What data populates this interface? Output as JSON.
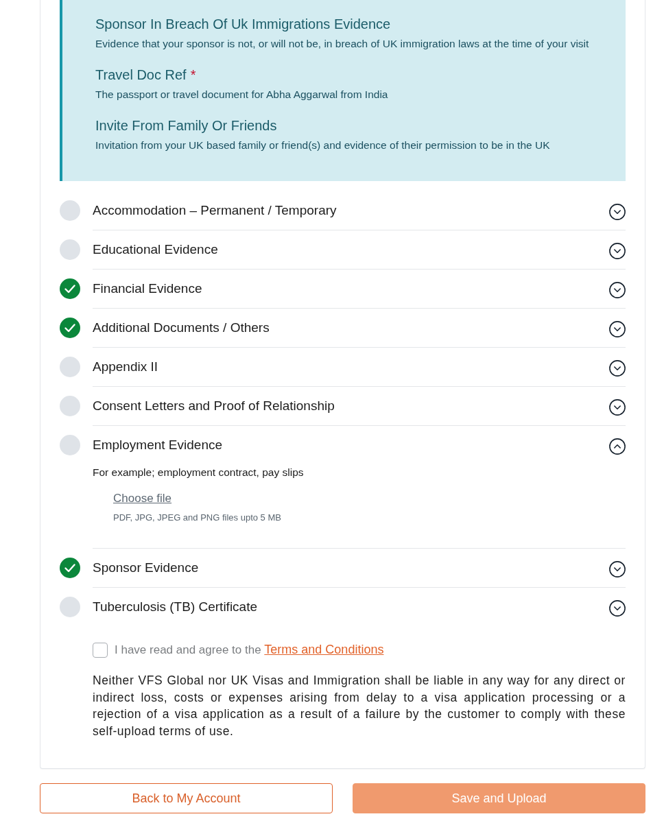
{
  "info_panel": {
    "items": [
      {
        "title": "Sponsor In Breach Of Uk Immigrations Evidence",
        "description": "Evidence that your sponsor is not, or will not be, in breach of UK immigration laws at the time of your visit"
      },
      {
        "title": "Travel Doc Ref",
        "required_mark": "*",
        "description": "The passport or travel document for Abha Aggarwal from India"
      },
      {
        "title": "Invite From Family Or Friends",
        "description": "Invitation from your UK based family or friend(s) and evidence of their permission to be in the UK"
      }
    ]
  },
  "documents": [
    {
      "title": "Accommodation – Permanent / Temporary",
      "uploaded": false,
      "expanded": false
    },
    {
      "title": "Educational Evidence",
      "uploaded": false,
      "expanded": false
    },
    {
      "title": "Financial Evidence",
      "uploaded": true,
      "expanded": false
    },
    {
      "title": "Additional Documents / Others",
      "uploaded": true,
      "expanded": false
    },
    {
      "title": "Appendix II",
      "uploaded": false,
      "expanded": false
    },
    {
      "title": "Consent Letters and Proof of Relationship",
      "uploaded": false,
      "expanded": false
    },
    {
      "title": "Employment Evidence",
      "uploaded": false,
      "expanded": true,
      "hint": "For example; employment contract, pay slips",
      "choose_file": "Choose file",
      "file_types": "PDF, JPG, JPEG and PNG files upto 5 MB"
    },
    {
      "title": "Sponsor Evidence",
      "uploaded": true,
      "expanded": false
    },
    {
      "title": "Tuberculosis (TB) Certificate",
      "uploaded": false,
      "expanded": false
    }
  ],
  "terms": {
    "checked": false,
    "text": "I have read and agree to the",
    "link": "Terms and Conditions"
  },
  "disclaimer": "Neither VFS Global nor UK Visas and Immigration shall be liable in any way for any direct or indirect loss, costs or expenses arising from delay to a visa application processing or a rejection of a visa application as a result of a failure by the customer to comply with these self-upload terms of use.",
  "buttons": [
    {
      "label": "Back to My Account",
      "kind": "secondary",
      "disabled": false
    },
    {
      "label": "Save and Upload",
      "kind": "primary",
      "disabled": true
    }
  ]
}
